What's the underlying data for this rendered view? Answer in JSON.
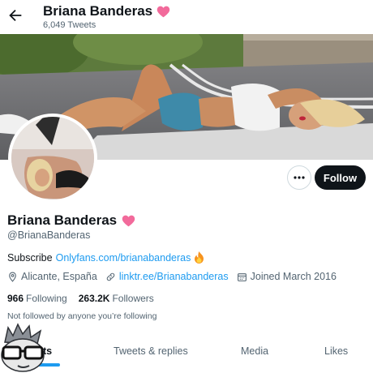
{
  "header": {
    "name": "Briana Banderas",
    "tweet_count": "6,049 Tweets"
  },
  "profile": {
    "display_name": "Briana Banderas",
    "handle": "@BrianaBanderas",
    "bio_prefix": "Subscribe",
    "bio_link": "Onlyfans.com/brianabanderas",
    "location": "Alicante, España",
    "website": "linktr.ee/Brianabanderas",
    "joined": "Joined March 2016",
    "following_count": "966",
    "following_label": "Following",
    "followers_count": "263.2K",
    "followers_label": "Followers",
    "not_followed_text": "Not followed by anyone you’re following"
  },
  "actions": {
    "follow_label": "Follow"
  },
  "tabs": [
    {
      "label": "ets"
    },
    {
      "label": "Tweets & replies"
    },
    {
      "label": "Media"
    },
    {
      "label": "Likes"
    }
  ],
  "colors": {
    "accent": "#1d9bf0",
    "heart": "#f91880",
    "text": "#0f1419",
    "muted": "#536471"
  }
}
